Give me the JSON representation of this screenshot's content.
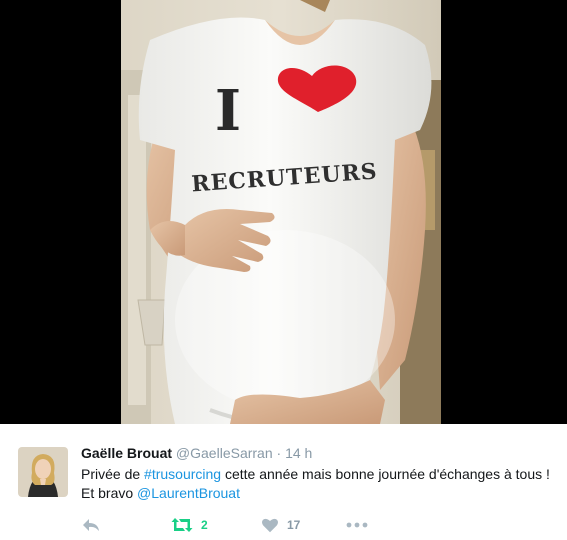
{
  "media": {
    "shirt_letter": "I",
    "shirt_word": "RECRUTEURS"
  },
  "tweet": {
    "fullname": "Gaëlle Brouat",
    "username": "@GaelleSarran",
    "separator": "·",
    "time": "14 h",
    "text_before": "Privée de ",
    "hashtag": "#trusourcing",
    "text_middle": " cette année mais bonne journée d'échanges à tous ! Et bravo ",
    "mention": "@LaurentBrouat"
  },
  "actions": {
    "retweet_count": "2",
    "like_count": "17"
  },
  "colors": {
    "link": "#1b95e0",
    "retweet_active": "#19cf86",
    "icon_gray": "#aab8c2",
    "heart_red": "#e0202c"
  },
  "icons": {
    "reply": "reply-icon",
    "retweet": "retweet-icon",
    "like": "heart-icon",
    "more": "more-icon"
  }
}
